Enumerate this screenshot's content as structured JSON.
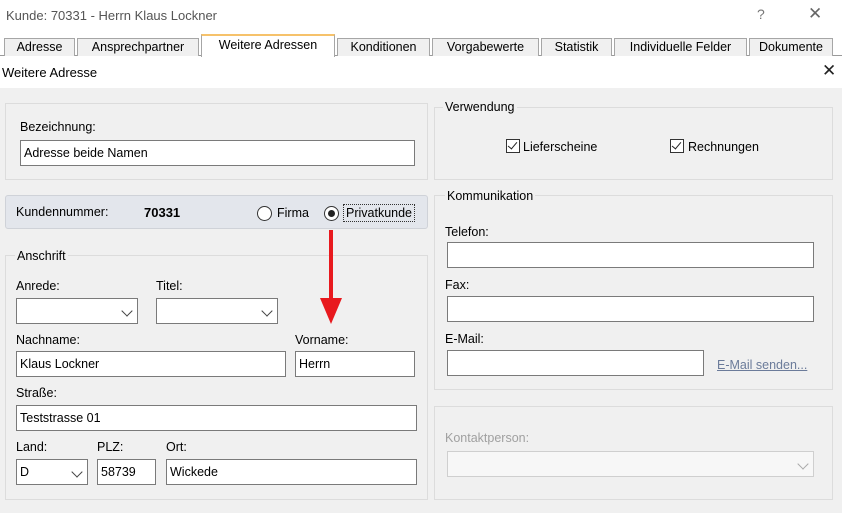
{
  "window": {
    "title": "Kunde: 70331 - Herrn Klaus Lockner",
    "help_glyph": "?",
    "close_glyph": "✕"
  },
  "tabs": [
    {
      "label": "Adresse"
    },
    {
      "label": "Ansprechpartner"
    },
    {
      "label": "Weitere Adressen",
      "active": true
    },
    {
      "label": "Konditionen"
    },
    {
      "label": "Vorgabewerte"
    },
    {
      "label": "Statistik"
    },
    {
      "label": "Individuelle Felder"
    },
    {
      "label": "Dokumente"
    }
  ],
  "dialog": {
    "title": "Weitere Adresse",
    "close_glyph": "✕"
  },
  "bezeichnung": {
    "label": "Bezeichnung:",
    "value": "Adresse beide Namen"
  },
  "kunde": {
    "label": "Kundennummer:",
    "number": "70331",
    "type_options": [
      {
        "label": "Firma",
        "selected": false
      },
      {
        "label": "Privatkunde",
        "selected": true
      }
    ]
  },
  "anschrift": {
    "legend": "Anschrift",
    "anrede": {
      "label": "Anrede:",
      "value": ""
    },
    "titel": {
      "label": "Titel:",
      "value": ""
    },
    "nachname": {
      "label": "Nachname:",
      "value": "Klaus Lockner"
    },
    "vorname": {
      "label": "Vorname:",
      "value": "Herrn"
    },
    "strasse": {
      "label": "Straße:",
      "value": "Teststrasse 01"
    },
    "land": {
      "label": "Land:",
      "value": "D"
    },
    "plz": {
      "label": "PLZ:",
      "value": "58739"
    },
    "ort": {
      "label": "Ort:",
      "value": "Wickede"
    }
  },
  "verwendung": {
    "legend": "Verwendung",
    "options": [
      {
        "label": "Lieferscheine",
        "checked": true
      },
      {
        "label": "Rechnungen",
        "checked": true
      }
    ]
  },
  "kommunikation": {
    "legend": "Kommunikation",
    "telefon": {
      "label": "Telefon:",
      "value": ""
    },
    "fax": {
      "label": "Fax:",
      "value": ""
    },
    "email": {
      "label": "E-Mail:",
      "value": ""
    },
    "email_send_link": "E-Mail senden..."
  },
  "kontaktperson": {
    "label": "Kontaktperson:",
    "value": ""
  },
  "annotation": {
    "arrow_color": "#e8191e"
  }
}
